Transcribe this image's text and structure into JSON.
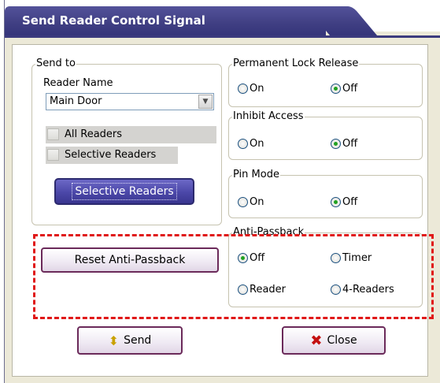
{
  "window": {
    "title": "Send Reader Control Signal"
  },
  "send_to": {
    "legend": "Send to",
    "reader_name_label": "Reader Name",
    "reader_name_value": "Main Door",
    "all_readers_label": "All Readers",
    "selective_readers_label": "Selective Readers",
    "selective_readers_button": "Selective Readers"
  },
  "permanent_lock_release": {
    "legend": "Permanent Lock Release",
    "on": "On",
    "off": "Off",
    "selected": "Off"
  },
  "inhibit_access": {
    "legend": "Inhibit Access",
    "on": "On",
    "off": "Off",
    "selected": "Off"
  },
  "pin_mode": {
    "legend": "Pin Mode",
    "on": "On",
    "off": "Off",
    "selected": "Off"
  },
  "anti_passback": {
    "legend": "Anti-Passback",
    "off": "Off",
    "timer": "Timer",
    "reader": "Reader",
    "four_readers": "4-Readers",
    "selected": "Off",
    "reset_button": "Reset Anti-Passback"
  },
  "buttons": {
    "send": "Send",
    "close": "Close"
  },
  "colors": {
    "title_bar": "#3f3e82",
    "highlight_dash": "#e01818",
    "button_purple": "#4b47a8"
  }
}
